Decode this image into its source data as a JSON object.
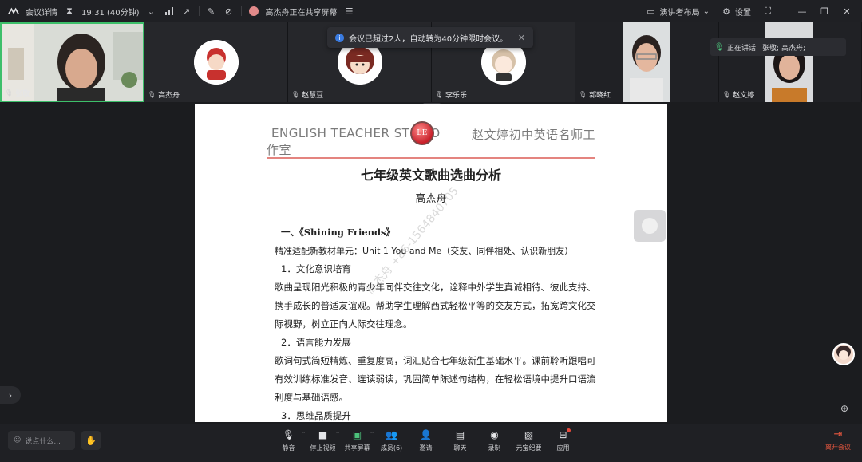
{
  "topbar": {
    "meeting_details": "会议详情",
    "time": "19:31 (40分钟)",
    "sharing_status": "高杰舟正在共享屏幕",
    "layout_label": "演讲者布局",
    "settings_label": "设置"
  },
  "participants": [
    {
      "name": "张敬",
      "type": "video"
    },
    {
      "name": "高杰舟",
      "type": "avatar"
    },
    {
      "name": "赵慧豆",
      "type": "avatar"
    },
    {
      "name": "李乐乐",
      "type": "avatar"
    },
    {
      "name": "郭晓红",
      "type": "video"
    },
    {
      "name": "赵文婷",
      "type": "video"
    }
  ],
  "notice": {
    "text": "会议已超过2人，自动转为40分钟限时会议。"
  },
  "speaking": {
    "label": "正在讲话:",
    "names": "张敬; 高杰舟;"
  },
  "document": {
    "header_en": "ENGLISH TEACHER ST",
    "header_en_tail": "O",
    "logo_text": "LE",
    "header_cn": "赵文婷初中英语名师工",
    "header_cn2": "作室",
    "title": "七年级英文歌曲选曲分析",
    "author": "高杰舟",
    "watermark": "高杰舟 +86-1564840705",
    "body": [
      {
        "kind": "h",
        "text": "一、《Shining Friends》"
      },
      {
        "kind": "p",
        "text": "精准适配新教材单元：Unit 1 You and Me（交友、同伴相处、认识新朋友）"
      },
      {
        "kind": "p",
        "text": "1．文化意识培育"
      },
      {
        "kind": "p",
        "text": "歌曲呈现阳光积极的青少年同伴交往文化，诠释中外学生真诚相待、彼此支持、携手成长的普适友谊观。帮助学生理解西式轻松平等的交友方式，拓宽跨文化交际视野，树立正向人际交往理念。"
      },
      {
        "kind": "p",
        "text": "2．语言能力发展"
      },
      {
        "kind": "p",
        "text": "歌词句式简短精炼、重复度高，词汇贴合七年级新生基础水平。课前聆听跟唱可有效训练标准发音、连读弱读，巩固简单陈述句结构，在轻松语境中提升口语流利度与基础语感。"
      },
      {
        "kind": "p",
        "text": "3．思维品质提升"
      }
    ]
  },
  "bottombar": {
    "chat_placeholder": "说点什么...",
    "controls": [
      {
        "label": "静音",
        "icon": "microphone-icon",
        "caret": true
      },
      {
        "label": "停止视频",
        "icon": "video-camera-icon",
        "caret": true
      },
      {
        "label": "共享屏幕",
        "icon": "share-screen-icon",
        "caret": true
      },
      {
        "label": "成员(6)",
        "icon": "members-icon",
        "caret": false
      },
      {
        "label": "邀请",
        "icon": "invite-icon",
        "caret": false
      },
      {
        "label": "聊天",
        "icon": "chat-icon",
        "caret": false
      },
      {
        "label": "录制",
        "icon": "record-icon",
        "caret": false
      },
      {
        "label": "元宝纪要",
        "icon": "minutes-icon",
        "caret": false
      },
      {
        "label": "应用",
        "icon": "apps-icon",
        "caret": false
      }
    ],
    "leave_label": "离开会议"
  }
}
